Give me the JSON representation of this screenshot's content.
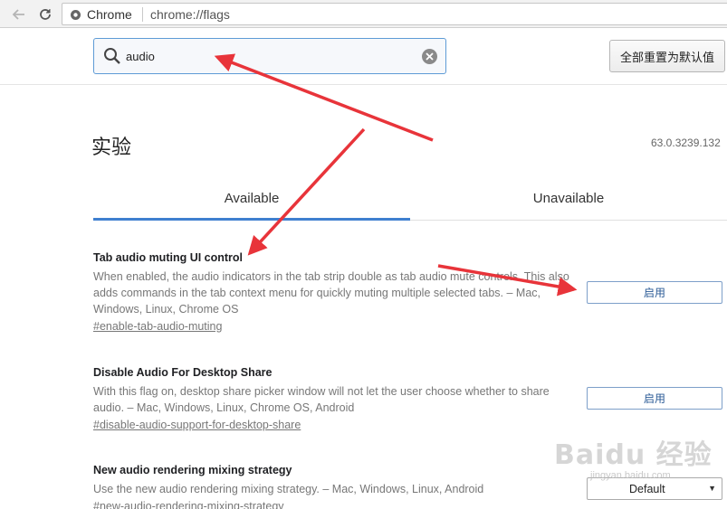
{
  "browser": {
    "origin_label": "Chrome",
    "url": "chrome://flags"
  },
  "header": {
    "search_value": "audio",
    "reset_label": "全部重置为默认值"
  },
  "page": {
    "title": "实验",
    "version": "63.0.3239.132"
  },
  "tabs": [
    {
      "label": "Available",
      "active": true
    },
    {
      "label": "Unavailable",
      "active": false
    }
  ],
  "experiments": [
    {
      "name": "Tab audio muting UI control",
      "description": "When enabled, the audio indicators in the tab strip double as tab audio mute controls. This also adds commands in the tab context menu for quickly muting multiple selected tabs. – Mac, Windows, Linux, Chrome OS",
      "link": "#enable-tab-audio-muting",
      "action": "启用"
    },
    {
      "name": "Disable Audio For Desktop Share",
      "description": "With this flag on, desktop share picker window will not let the user choose whether to share audio. – Mac, Windows, Linux, Chrome OS, Android",
      "link": "#disable-audio-support-for-desktop-share",
      "action": "启用"
    },
    {
      "name": "New audio rendering mixing strategy",
      "description": "Use the new audio rendering mixing strategy. – Mac, Windows, Linux, Android",
      "link": "#new-audio-rendering-mixing-strategy",
      "action": "Default"
    }
  ],
  "watermark": {
    "brand": "Baidu 经验",
    "site": "jingyan.baidu.com"
  },
  "colors": {
    "accent": "#3f7fcf",
    "annotation_arrow": "#e8343a"
  },
  "icons": {
    "back": "arrow-left",
    "reload": "reload",
    "search": "magnifier",
    "clear": "close-circle",
    "select": "triangle-down"
  }
}
